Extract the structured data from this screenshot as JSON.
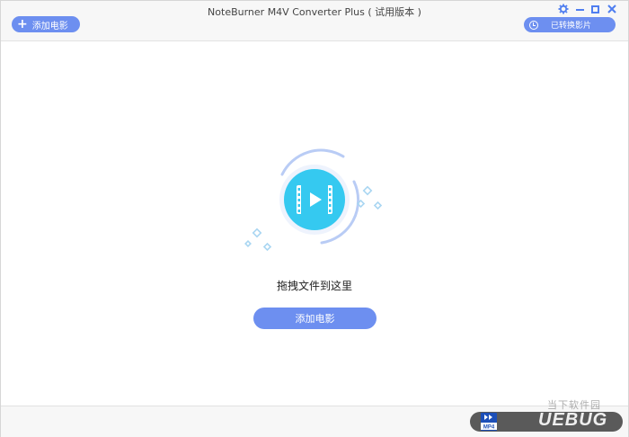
{
  "window": {
    "title": "NoteBurner M4V Converter Plus ( 试用版本 )"
  },
  "toolbar": {
    "add_movie_label": "添加电影",
    "converted_label": "已转换影片"
  },
  "window_controls": {
    "settings_icon": "gear-icon",
    "minimize_icon": "minimize-icon",
    "maximize_icon": "maximize-icon",
    "close_icon": "close-icon"
  },
  "drop_area": {
    "prompt": "拖拽文件到这里",
    "add_movie_button": "添加电影"
  },
  "footer": {
    "format_badge": "MP4",
    "watermark_cn": "当下软件园",
    "watermark_en": "UEBUG"
  },
  "colors": {
    "accent": "#6d8ff0",
    "icon_blue": "#4f7ef0",
    "illus_cyan": "#35c9f0"
  }
}
